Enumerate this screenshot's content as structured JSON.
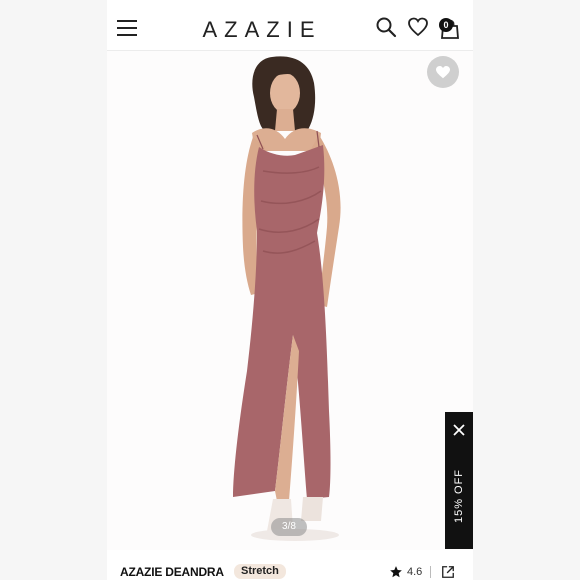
{
  "header": {
    "brand": "AZAZIE",
    "cart_count": "0",
    "icons": [
      "menu-icon",
      "search-icon",
      "heart-icon",
      "bag-icon"
    ]
  },
  "gallery": {
    "counter": "3/8",
    "wishlist_icon": "heart-icon"
  },
  "promo": {
    "label": "15% OFF",
    "close_icon": "close-icon"
  },
  "product": {
    "name": "AZAZIE DEANDRA",
    "tag": "Stretch",
    "rating": "4.6",
    "share_icon": "share-icon"
  },
  "colors": {
    "dress": "#a8666a",
    "promo_bg": "#111111",
    "tag_bg": "#f3e7dd"
  }
}
